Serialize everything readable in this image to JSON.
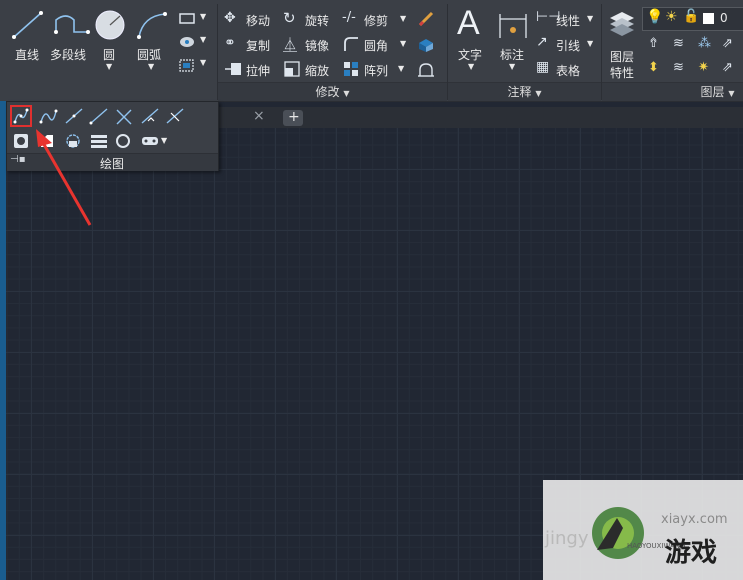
{
  "ribbon": {
    "draw": {
      "line": "直线",
      "polyline": "多段线",
      "circle": "圆",
      "arc": "圆弧",
      "panel_title": "绘图"
    },
    "modify": {
      "move": "移动",
      "rotate": "旋转",
      "trim": "修剪",
      "copy": "复制",
      "mirror": "镜像",
      "fillet": "圆角",
      "stretch": "拉伸",
      "scale": "缩放",
      "array": "阵列",
      "panel_title": "修改"
    },
    "annotation": {
      "text": "文字",
      "dimension": "标注",
      "linear": "线性",
      "leader": "引线",
      "table": "表格",
      "panel_title": "注释"
    },
    "layers": {
      "layer_properties_line1": "图层",
      "layer_properties_line2": "特性",
      "current_layer": "0",
      "panel_title": "图层"
    }
  },
  "tabs": {
    "close_glyph": "×",
    "add_glyph": "+"
  },
  "watermark": {
    "site": "xiayx.com",
    "brand": "游戏",
    "pinyin": "HAOYOUXIWANG",
    "left_text": "jingy"
  },
  "colors": {
    "ribbon_bg": "#3b3f46",
    "canvas_bg": "#212733",
    "highlight": "#e0302f",
    "arrow": "#e8342f",
    "accent_blue": "#2a7fc1"
  }
}
